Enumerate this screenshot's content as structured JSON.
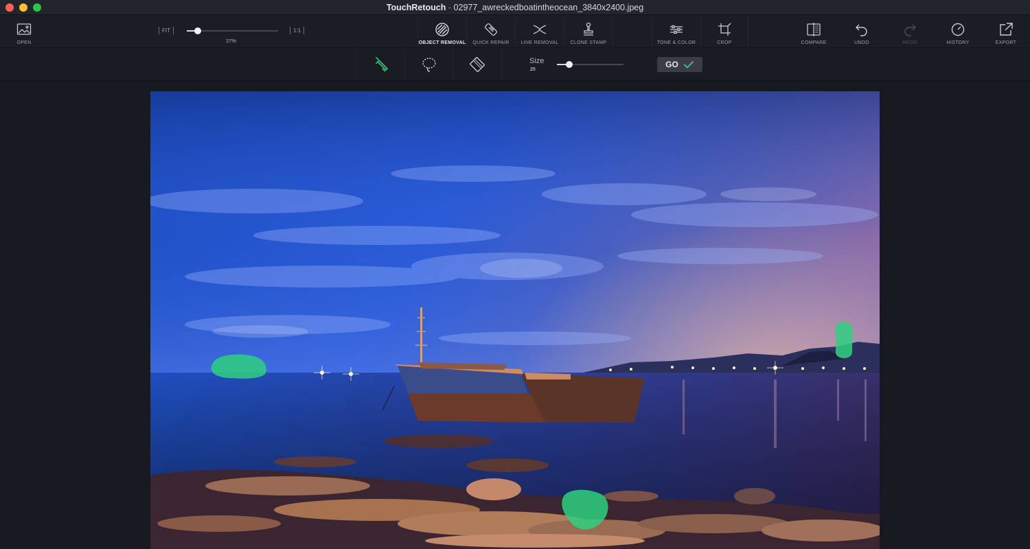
{
  "window": {
    "app_name": "TouchRetouch",
    "separator": "-",
    "file_name": "02977_awreckedboatintheocean_3840x2400.jpeg"
  },
  "toolbar": {
    "open_label": "OPEN",
    "zoom": {
      "fit_label": "FIT",
      "one_to_one_label": "1:1",
      "value": "27%",
      "fraction": 0.27
    },
    "tools": [
      {
        "label": "OBJECT REMOVAL",
        "icon": "object-removal-icon",
        "active": true
      },
      {
        "label": "QUICK REPAIR",
        "icon": "quick-repair-icon"
      },
      {
        "label": "LINE REMOVAL",
        "icon": "line-removal-icon"
      },
      {
        "label": "CLONE STAMP",
        "icon": "clone-stamp-icon"
      },
      {
        "label": "TONE & COLOR",
        "icon": "tone-color-icon"
      },
      {
        "label": "CROP",
        "icon": "crop-icon"
      }
    ],
    "right": [
      {
        "label": "COMPARE",
        "icon": "compare-icon"
      },
      {
        "label": "UNDO",
        "icon": "undo-icon"
      },
      {
        "label": "REDO",
        "icon": "redo-icon",
        "disabled": true
      },
      {
        "label": "HISTORY",
        "icon": "history-icon"
      },
      {
        "label": "EXPORT",
        "icon": "export-icon"
      }
    ]
  },
  "subtoolbar": {
    "tools": [
      {
        "icon": "brush-icon",
        "active": true
      },
      {
        "icon": "lasso-icon"
      },
      {
        "icon": "eraser-icon"
      }
    ],
    "size_label": "Size",
    "size_value": "25",
    "go_label": "GO"
  },
  "colors": {
    "accent_green": "#3cc47a",
    "selection_overlay": "#2fd07f"
  }
}
